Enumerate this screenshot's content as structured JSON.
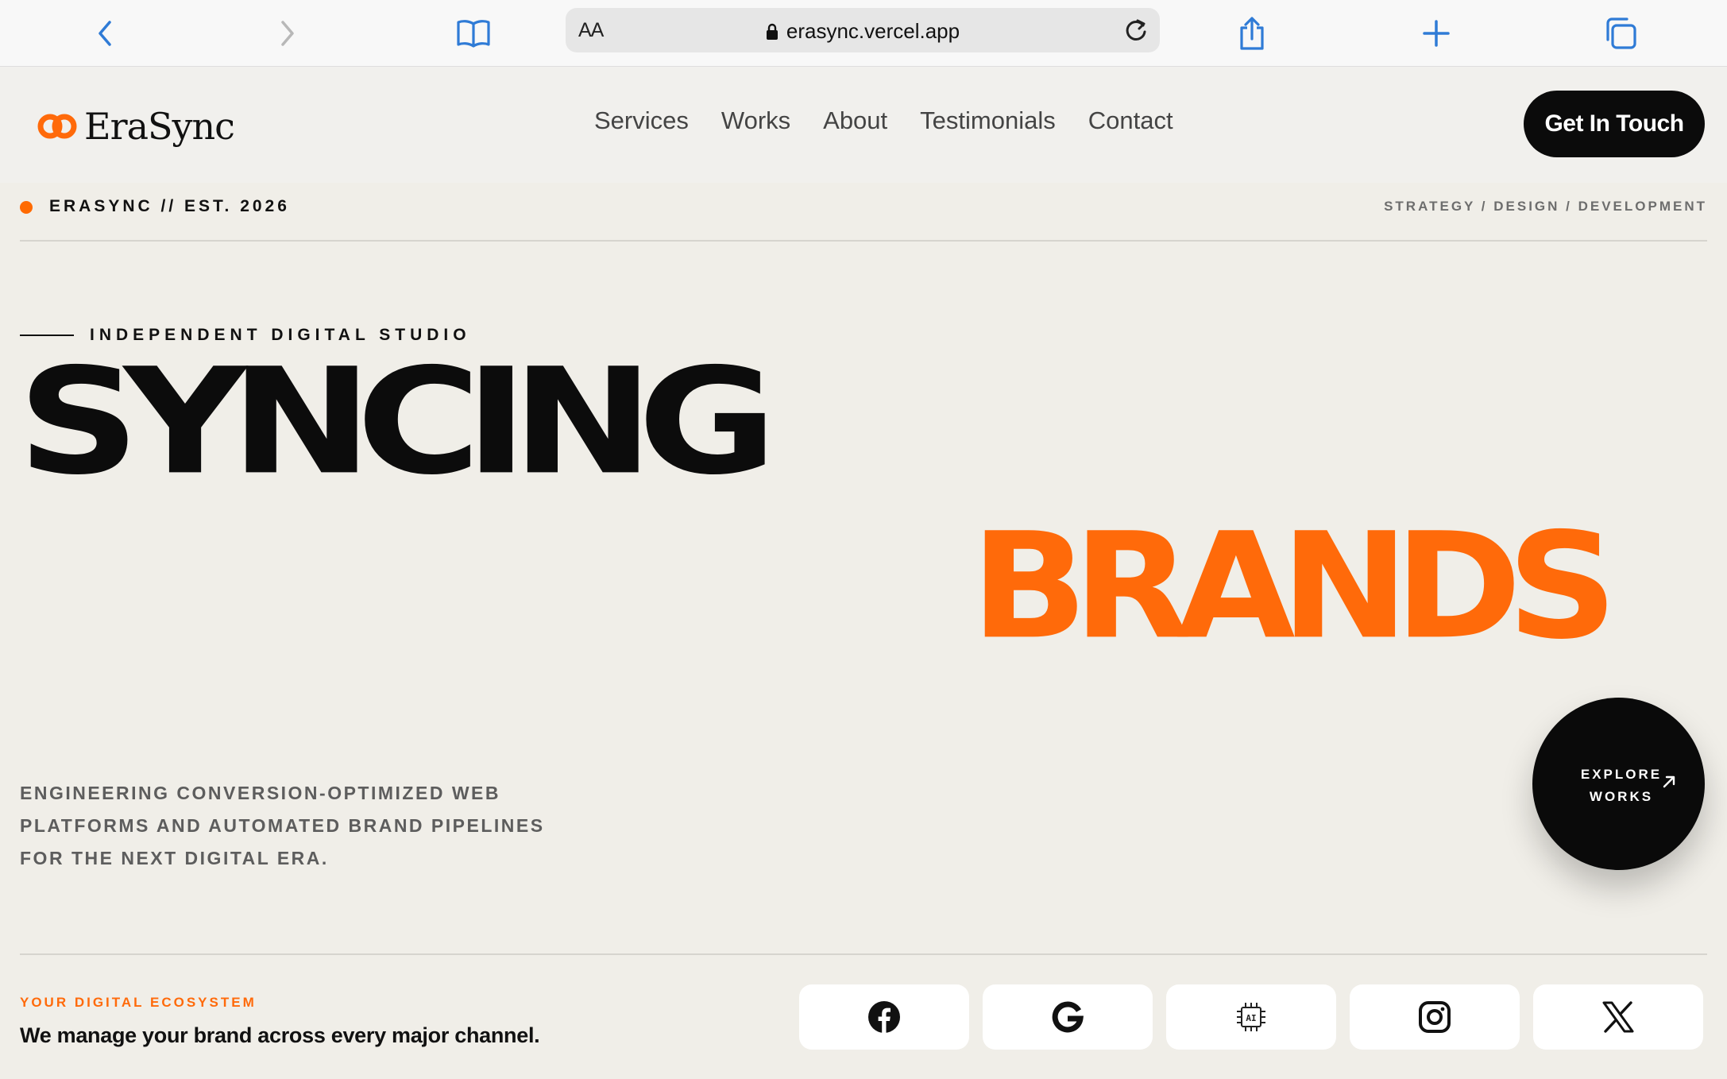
{
  "browser": {
    "url_aa": "AA",
    "url": "erasync.vercel.app"
  },
  "header": {
    "logo_text": "EraSync",
    "nav": [
      "Services",
      "Works",
      "About",
      "Testimonials",
      "Contact"
    ],
    "cta": "Get In Touch"
  },
  "strip": {
    "left": "ERASYNC // EST. 2026",
    "right": "STRATEGY / DESIGN / DEVELOPMENT"
  },
  "hero": {
    "eyebrow": "INDEPENDENT DIGITAL STUDIO",
    "line1": "SYNCING",
    "line2": "BRANDS",
    "tagline": "ENGINEERING CONVERSION-OPTIMIZED WEB PLATFORMS AND AUTOMATED BRAND PIPELINES FOR THE NEXT DIGITAL ERA.",
    "explore_line1": "EXPLORE",
    "explore_line2": "WORKS"
  },
  "ecosystem": {
    "label": "YOUR DIGITAL ECOSYSTEM",
    "text": "We manage your brand across every major channel.",
    "channels": [
      "facebook-icon",
      "google-icon",
      "ai-chip-icon",
      "instagram-icon",
      "x-icon"
    ]
  },
  "colors": {
    "accent": "#ff6a0a",
    "dark": "#0b0b0b",
    "background": "#f0eee8",
    "browser_blue": "#2f7bd6"
  }
}
